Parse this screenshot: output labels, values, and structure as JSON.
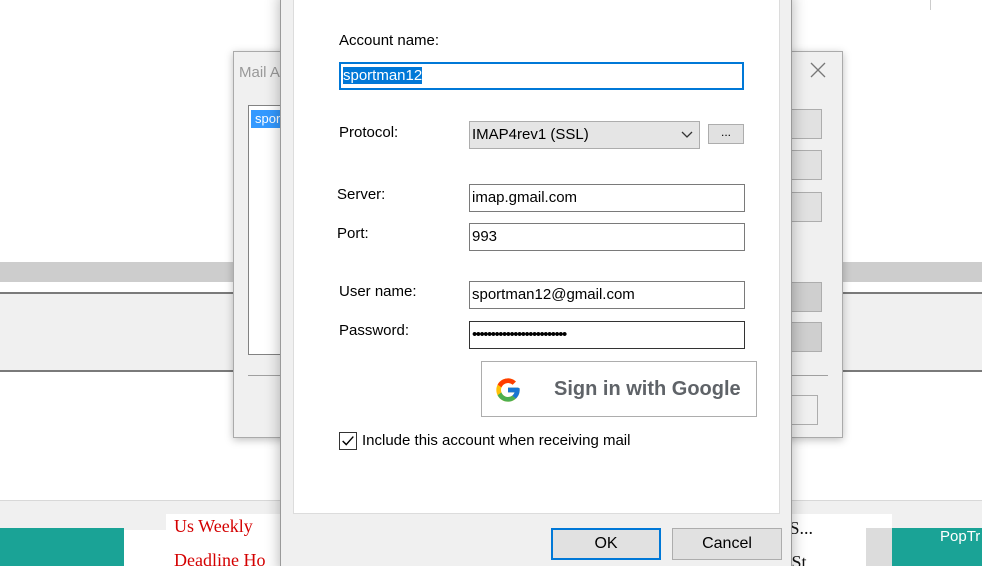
{
  "background": {
    "news_left": [
      "Us Weekly",
      "Deadline Ho"
    ],
    "news_right": [
      "n S...",
      "t St"
    ],
    "teal_label": "PopTr"
  },
  "mail_window": {
    "title": "Mail A",
    "list_item": "spor"
  },
  "dialog": {
    "account_name_label": "Account name:",
    "account_name_value": "sportman12",
    "protocol_label": "Protocol:",
    "protocol_value": "IMAP4rev1 (SSL)",
    "protocol_more_label": "...",
    "server_label": "Server:",
    "server_value": "imap.gmail.com",
    "port_label": "Port:",
    "port_value": "993",
    "username_label": "User name:",
    "username_value": "sportman12@gmail.com",
    "password_label": "Password:",
    "password_value": "•••••••••••••••••••••••••",
    "google_button_label": "Sign in with Google",
    "include_checkbox_label": "Include this account when receiving mail",
    "include_checked": true,
    "ok_label": "OK",
    "cancel_label": "Cancel"
  },
  "colors": {
    "accent": "#0078d7",
    "teal": "#1aa396",
    "news_red": "#d40000"
  }
}
